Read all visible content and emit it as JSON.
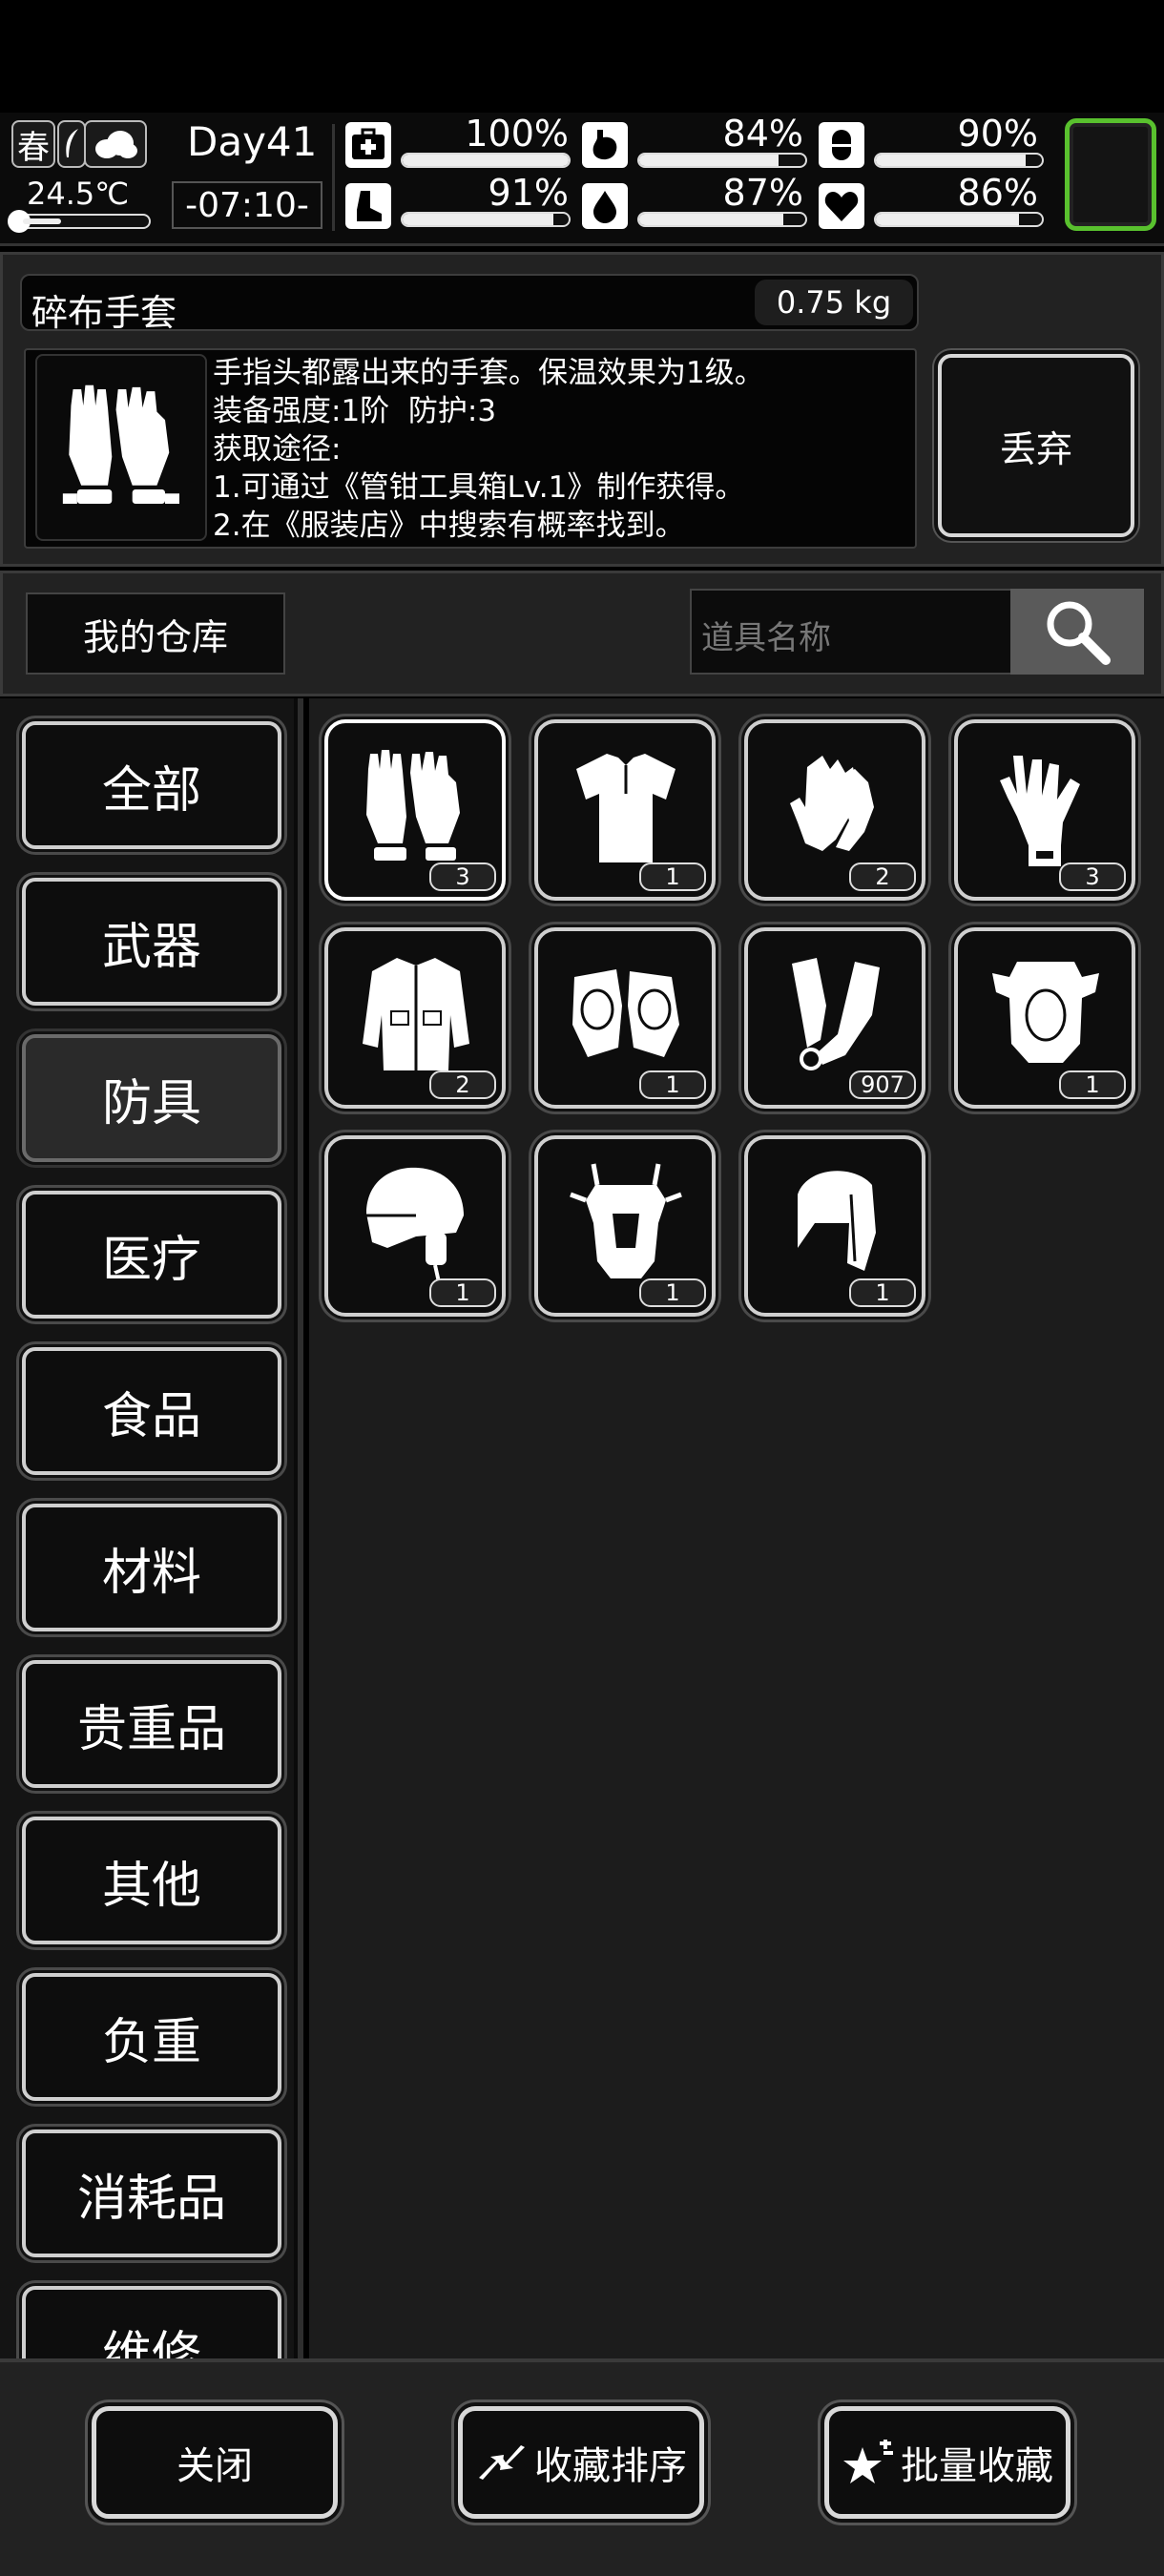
{
  "status": {
    "season": "春",
    "temperature": "24.5℃",
    "day": "Day41",
    "time": "-07:10-",
    "stats": [
      {
        "name": "health",
        "icon": "medkit-icon",
        "value": "100%",
        "level": 100
      },
      {
        "name": "hunger",
        "icon": "stomach-icon",
        "value": "84%",
        "level": 84
      },
      {
        "name": "energy",
        "icon": "pill-icon",
        "value": "90%",
        "level": 90
      },
      {
        "name": "stamina",
        "icon": "boot-icon",
        "value": "91%",
        "level": 91
      },
      {
        "name": "thirst",
        "icon": "water-drop-icon",
        "value": "87%",
        "level": 87
      },
      {
        "name": "mood",
        "icon": "heart-icon",
        "value": "86%",
        "level": 86
      }
    ]
  },
  "selected_item": {
    "name": "碎布手套",
    "weight": "0.75 kg",
    "description_lines": [
      "手指头都露出来的手套。保温效果为1级。",
      "装备强度:1阶  防护:3",
      "获取途径:",
      "1.可通过《管钳工具箱Lv.1》制作获得。",
      "2.在《服装店》中搜索有概率找到。"
    ],
    "discard_label": "丢弃"
  },
  "storage": {
    "title": "我的仓库",
    "search_placeholder": "道具名称"
  },
  "categories": [
    "全部",
    "武器",
    "防具",
    "医疗",
    "食品",
    "材料",
    "贵重品",
    "其他",
    "负重",
    "消耗品",
    "维修"
  ],
  "active_category": "防具",
  "items": [
    {
      "icon": "fingerless-glove-icon",
      "count": "3",
      "selected": true
    },
    {
      "icon": "shirt-icon",
      "count": "1"
    },
    {
      "icon": "work-gloves-icon",
      "count": "2"
    },
    {
      "icon": "leather-glove-icon",
      "count": "3"
    },
    {
      "icon": "jacket-icon",
      "count": "2"
    },
    {
      "icon": "knee-pads-icon",
      "count": "1"
    },
    {
      "icon": "arm-guards-icon",
      "count": "907"
    },
    {
      "icon": "body-armor-icon",
      "count": "1"
    },
    {
      "icon": "helmet-icon",
      "count": "1"
    },
    {
      "icon": "chest-plate-icon",
      "count": "1"
    },
    {
      "icon": "hood-icon",
      "count": "1"
    }
  ],
  "buttons": {
    "close": "关闭",
    "sort_favorites": "收藏排序",
    "batch_favorite": "批量收藏"
  }
}
